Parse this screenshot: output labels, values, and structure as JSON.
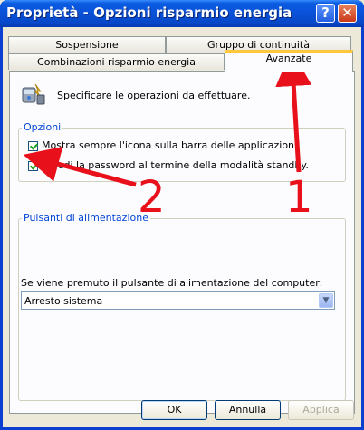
{
  "window": {
    "title": "Proprietà - Opzioni risparmio energia",
    "help_glyph": "?",
    "close_glyph": "✕"
  },
  "tabs": {
    "row1": [
      "Sospensione",
      "Gruppo di continuità"
    ],
    "row2": [
      "Combinazioni risparmio energia",
      "Avanzate"
    ],
    "active": "Avanzate"
  },
  "intro": {
    "text": "Specificare le operazioni da effettuare."
  },
  "options": {
    "label": "Opzioni",
    "items": [
      {
        "label": "Mostra sempre l'icona sulla barra delle applicazioni.",
        "checked": true
      },
      {
        "label": "Chiedi la password al termine della modalità standby.",
        "checked": true
      }
    ]
  },
  "power_buttons": {
    "label": "Pulsanti di alimentazione",
    "prompt": "Se viene premuto il pulsante di alimentazione del computer:",
    "selected": "Arresto sistema"
  },
  "buttons": {
    "ok": "OK",
    "cancel": "Annulla",
    "apply": "Applica"
  },
  "annotations": {
    "one": "1",
    "two": "2",
    "color": "#e8101b"
  }
}
